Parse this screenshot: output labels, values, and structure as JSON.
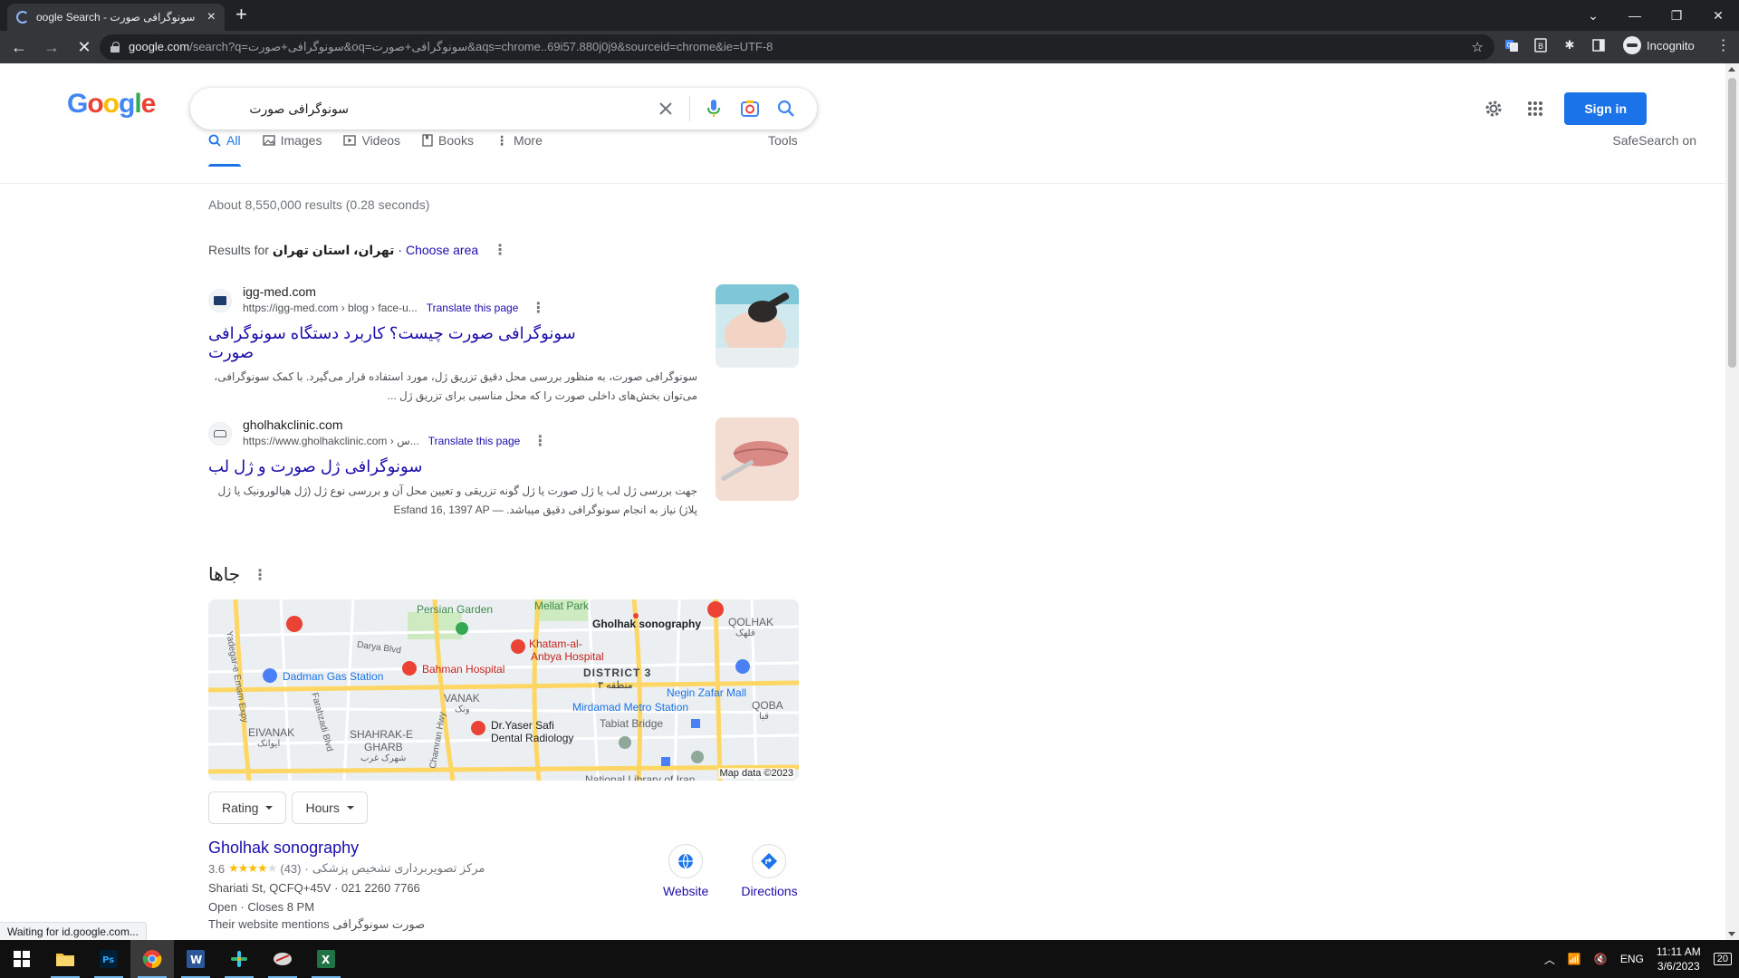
{
  "browser": {
    "tab_title": "oogle Search - سونوگرافی صورت",
    "url_host": "google.com",
    "url_rest": "/search?q=سونوگرافی+صورت&oq=سونوگرافی+صورت&aqs=chrome..69i57.880j0j9&sourceid=chrome&ie=UTF-8",
    "profile_label": "Incognito"
  },
  "search": {
    "query": "سونوگرافی صورت",
    "signin_label": "Sign in",
    "tabs": [
      "All",
      "Images",
      "Videos",
      "Books",
      "More"
    ],
    "tools_label": "Tools",
    "safesearch_label": "SafeSearch on",
    "stats": "About 8,550,000 results (0.28 seconds)",
    "results_for_prefix": "Results for",
    "results_for_location": "تهران، استان تهران",
    "choose_area": "· Choose area"
  },
  "results": [
    {
      "site": "igg-med.com",
      "url": "https://igg-med.com › blog › face-u...",
      "translate": "Translate this page",
      "title": "سونوگرافی صورت چیست؟ کاربرد دستگاه سونوگرافی صورت",
      "snippet": "سونوگرافی صورت، به منظور بررسی محل دقیق تزریق ژل، مورد استفاده قرار می‌گیرد. با کمک سونوگرافی، می‌توان بخش‌های داخلی صورت را که محل مناسبی برای تزریق ژل ..."
    },
    {
      "site": "gholhakclinic.com",
      "url": "https://www.gholhakclinic.com › س...",
      "translate": "Translate this page",
      "title": "سونوگرافی ژل صورت و ژل لب",
      "date": "Esfand 16, 1397 AP —",
      "snippet": "جهت بررسی ژل لب یا ژل صورت یا ژل گونه تزریقی و تعیین محل آن و بررسی نوع ژل (ژل هیالورونیک یا ژل پلاژ) نیاز به انجام سونوگرافی دقیق میباشد."
    }
  ],
  "places": {
    "title": "جاها",
    "map_labels": {
      "persian_garden": "Persian Garden",
      "mellat_park": "Mellat Park",
      "gholhak": "Gholhak sonography",
      "qolhak": "QOLHAK",
      "qolhak_fa": "قلهک",
      "khatam": "Khatam-al-",
      "anbya": "Anbya Hospital",
      "darya": "Darya Blvd",
      "yadegar": "Yadegar-e Emam Expy",
      "dadman": "Dadman Gas Station",
      "bahman": "Bahman Hospital",
      "district": "DISTRICT 3",
      "district_fa": "منطقه ۳",
      "negin": "Negin Zafar Mall",
      "qoba": "QOBA",
      "qoba_fa": "قبا",
      "mirdamad": "Mirdamad Metro Station",
      "vanak": "VANAK",
      "vanak_fa": "ونک",
      "eivanak": "EIVANAK",
      "eivanak_fa": "ایوانک",
      "farahzadi": "Farahzadi Blvd",
      "shahrak": "SHAHRAK-E",
      "gharb": "GHARB",
      "gharb_fa": "شهرک غرب",
      "chamran": "Chamran Hwy",
      "yaser1": "Dr.Yaser Safi",
      "yaser2": "Dental Radiology",
      "tabiat": "Tabiat Bridge",
      "national": "National Library of Iran",
      "copyright": "Map data ©2023"
    },
    "filters": [
      "Rating",
      "Hours"
    ],
    "listing": {
      "name": "Gholhak sonography",
      "rating": "3.6",
      "rating_value": 3.6,
      "reviews": "(43)",
      "category": "مرکز تصویربرداری تشخیص پزشکی",
      "address": "Shariati St, QCFQ+45V · 021 2260 7766",
      "hours": "Open · Closes 8 PM",
      "mention": "Their website mentions صورت سونوگرافی",
      "website_label": "Website",
      "directions_label": "Directions"
    }
  },
  "status": "Waiting for id.google.com...",
  "taskbar": {
    "lang": "ENG",
    "time": "11:11 AM",
    "date": "3/6/2023",
    "notifications": "20"
  },
  "colors": {
    "google_blue": "#1a73e8",
    "link": "#1a0dab",
    "chrome_dark": "#35363a"
  }
}
